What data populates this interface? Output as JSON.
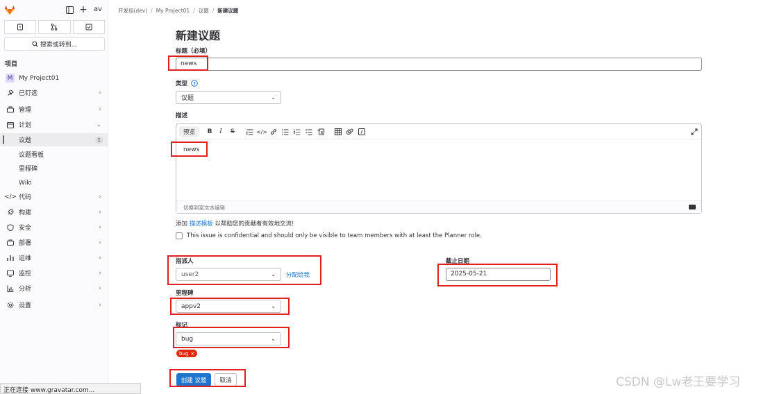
{
  "sidebar": {
    "avatar_text": "av",
    "search_label": "搜索或转到...",
    "section_title": "项目",
    "project_badge": "M",
    "items": [
      {
        "label": "My Project01",
        "icon": "project-badge"
      },
      {
        "label": "已钉选",
        "icon": "pin-icon",
        "chevron": "›"
      },
      {
        "label": "管理",
        "icon": "manage-icon",
        "chevron": "›"
      },
      {
        "label": "计划",
        "icon": "plan-icon",
        "chevron": "⌄"
      },
      {
        "label": "议题",
        "count": "1"
      },
      {
        "label": "议题看板"
      },
      {
        "label": "里程碑"
      },
      {
        "label": "Wiki"
      },
      {
        "label": "代码",
        "icon": "code-icon",
        "chevron": "›"
      },
      {
        "label": "构建",
        "icon": "rocket-icon",
        "chevron": "›"
      },
      {
        "label": "安全",
        "icon": "shield-icon",
        "chevron": "›"
      },
      {
        "label": "部署",
        "icon": "deploy-icon",
        "chevron": "›"
      },
      {
        "label": "运维",
        "icon": "operate-icon",
        "chevron": "›"
      },
      {
        "label": "监控",
        "icon": "monitor-icon",
        "chevron": "›"
      },
      {
        "label": "分析",
        "icon": "chart-icon",
        "chevron": "›"
      },
      {
        "label": "设置",
        "icon": "gear-icon",
        "chevron": "›"
      }
    ]
  },
  "status_bar": "正在连接 www.gravatar.com...",
  "breadcrumb": [
    "开发组(dev)",
    "My Project01",
    "议题",
    "新建议题"
  ],
  "form": {
    "page_title": "新建议题",
    "title_label": "标题（必填）",
    "title_value": "news",
    "type_label": "类型",
    "type_value": "议题",
    "description_label": "描述",
    "preview_tab": "预览",
    "description_value": "news",
    "switch_editor": "切换到富文本编辑",
    "hint_prefix": "添加",
    "hint_link": "描述模板",
    "hint_suffix": "以帮助您的贡献者有效地交流!",
    "confidential_text": "This issue is confidential and should only be visible to team members with at least the Planner role.",
    "assignee_label": "指派人",
    "assignee_value": "user2",
    "assign_to_me": "分配给我",
    "due_date_label": "截止日期",
    "due_date_value": "2025-05-21",
    "milestone_label": "里程碑",
    "milestone_value": "appv2",
    "labels_label": "标记",
    "labels_value": "bug",
    "tag_text": "bug",
    "create_button": "创建 议题",
    "cancel_button": "取消"
  },
  "watermark": "CSDN @Lw老王要学习",
  "colors": {
    "accent": "#1f75cb",
    "highlight_box": "#e02020",
    "tag_bug": "#dd2b0e"
  }
}
